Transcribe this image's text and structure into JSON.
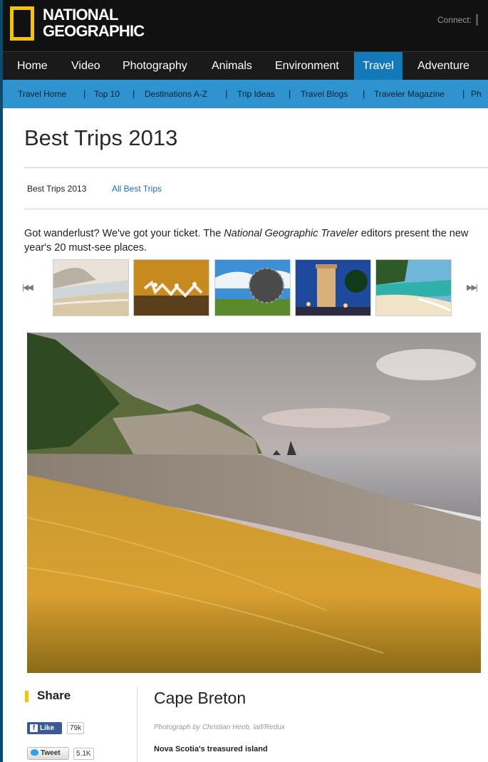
{
  "header": {
    "logo_line1": "NATIONAL",
    "logo_line2": "GEOGRAPHIC",
    "connect_label": "Connect:"
  },
  "main_nav": {
    "items": [
      {
        "label": "Home"
      },
      {
        "label": "Video"
      },
      {
        "label": "Photography"
      },
      {
        "label": "Animals"
      },
      {
        "label": "Environment"
      },
      {
        "label": "Travel",
        "active": true
      },
      {
        "label": "Adventure"
      }
    ]
  },
  "sub_nav": {
    "items": [
      {
        "label": "Travel Home"
      },
      {
        "label": "Top 10"
      },
      {
        "label": "Destinations A-Z"
      },
      {
        "label": "Trip Ideas"
      },
      {
        "label": "Travel Blogs"
      },
      {
        "label": "Traveler Magazine"
      },
      {
        "label": "Ph"
      }
    ],
    "separator": "|"
  },
  "page": {
    "title": "Best Trips 2013",
    "breadcrumb_current": "Best Trips 2013",
    "breadcrumb_link": "All Best Trips",
    "intro_part1": "Got wanderlust? We've got your ticket. The ",
    "intro_italic": "National Geographic Traveler",
    "intro_part2": " editors present the new year's 20 must-see places."
  },
  "carousel": {
    "prev_glyph": "|◀◀",
    "next_glyph": "▶▶|"
  },
  "share": {
    "title": "Share",
    "like_label": "Like",
    "like_count": "79k",
    "tweet_label": "Tweet",
    "tweet_count": "5.1K"
  },
  "caption": {
    "title": "Cape Breton",
    "credit": "Photograph by Christian Heeb, laif/Redux",
    "subhead": "Nova Scotia's treasured island"
  },
  "colors": {
    "brand_yellow": "#f5c400",
    "nav_active": "#1479b8",
    "subnav_bg": "#2f93d0",
    "link_blue": "#1f6fb0"
  }
}
